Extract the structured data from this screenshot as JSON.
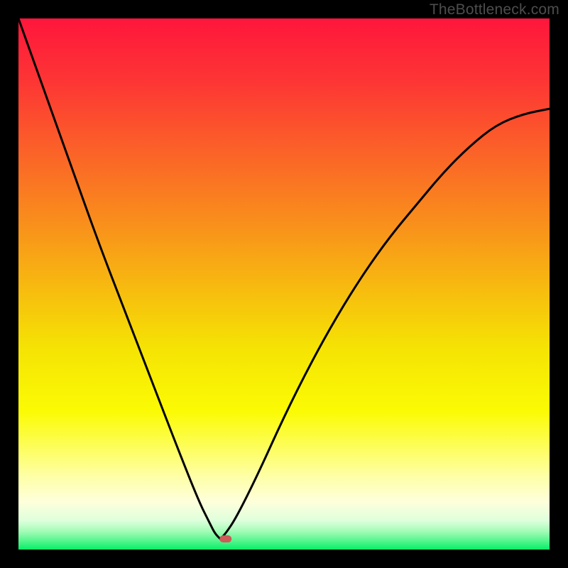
{
  "watermark": "TheBottleneck.com",
  "chart_data": {
    "type": "line",
    "title": "",
    "xlabel": "",
    "ylabel": "",
    "xlim": [
      0,
      100
    ],
    "ylim": [
      0,
      100
    ],
    "grid": false,
    "legend": false,
    "cusp": {
      "x": 38,
      "y": 2
    },
    "series": [
      {
        "name": "curve",
        "x": [
          0,
          5,
          10,
          15,
          20,
          25,
          30,
          34,
          36,
          37,
          38,
          39,
          41,
          45,
          50,
          55,
          60,
          65,
          70,
          75,
          80,
          85,
          90,
          95,
          100
        ],
        "y": [
          100,
          86,
          72,
          58,
          45,
          32,
          19,
          9,
          5,
          3,
          2,
          3,
          6,
          14,
          25,
          35,
          44,
          52,
          59,
          65,
          71,
          76,
          80,
          82,
          83
        ]
      }
    ],
    "marker": {
      "x": 39,
      "y": 2,
      "color": "#cd5b57"
    },
    "background_gradient": {
      "stops": [
        {
          "offset": 0.0,
          "color": "#fe163c"
        },
        {
          "offset": 0.12,
          "color": "#fd3634"
        },
        {
          "offset": 0.25,
          "color": "#fb6228"
        },
        {
          "offset": 0.38,
          "color": "#f98d1c"
        },
        {
          "offset": 0.5,
          "color": "#f7b810"
        },
        {
          "offset": 0.62,
          "color": "#f5e304"
        },
        {
          "offset": 0.74,
          "color": "#fbfb04"
        },
        {
          "offset": 0.8,
          "color": "#fdfd52"
        },
        {
          "offset": 0.86,
          "color": "#feffa3"
        },
        {
          "offset": 0.91,
          "color": "#feffdb"
        },
        {
          "offset": 0.945,
          "color": "#dfffdc"
        },
        {
          "offset": 0.965,
          "color": "#a6fcb7"
        },
        {
          "offset": 0.985,
          "color": "#4ef58a"
        },
        {
          "offset": 1.0,
          "color": "#07ee68"
        }
      ]
    }
  }
}
